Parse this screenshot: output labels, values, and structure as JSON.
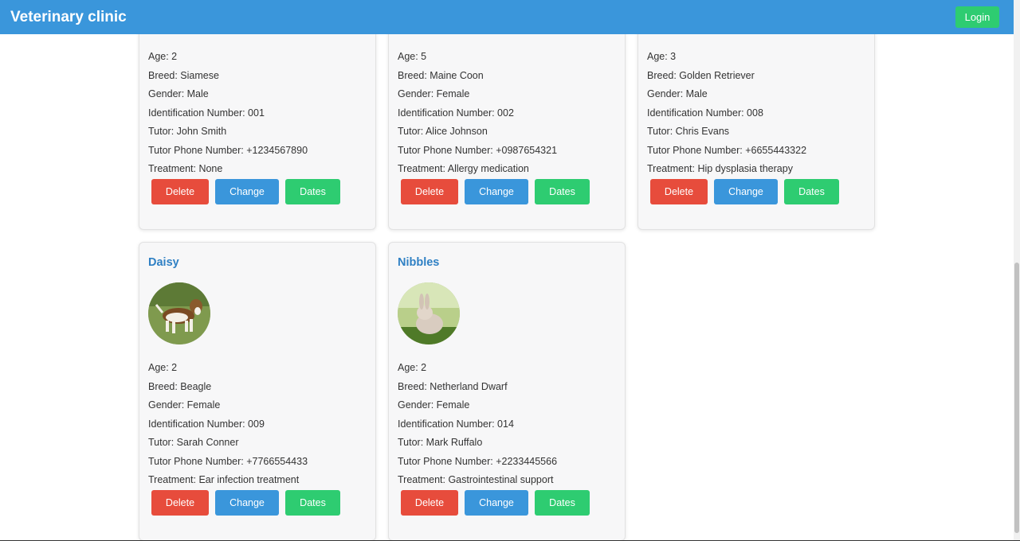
{
  "header": {
    "title": "Veterinary clinic",
    "login_label": "Login"
  },
  "actions": {
    "delete": "Delete",
    "change": "Change",
    "dates": "Dates"
  },
  "pets": [
    {
      "name": "",
      "age": "Age: 2",
      "breed": "Breed: Siamese",
      "gender": "Gender: Male",
      "id": "Identification Number: 001",
      "tutor": "Tutor: John Smith",
      "phone": "Tutor Phone Number: +1234567890",
      "treatment": "Treatment: None"
    },
    {
      "name": "",
      "age": "Age: 5",
      "breed": "Breed: Maine Coon",
      "gender": "Gender: Female",
      "id": "Identification Number: 002",
      "tutor": "Tutor: Alice Johnson",
      "phone": "Tutor Phone Number: +0987654321",
      "treatment": "Treatment: Allergy medication"
    },
    {
      "name": "",
      "age": "Age: 3",
      "breed": "Breed: Golden Retriever",
      "gender": "Gender: Male",
      "id": "Identification Number: 008",
      "tutor": "Tutor: Chris Evans",
      "phone": "Tutor Phone Number: +6655443322",
      "treatment": "Treatment: Hip dysplasia therapy"
    },
    {
      "name": "Daisy",
      "age": "Age: 2",
      "breed": "Breed: Beagle",
      "gender": "Gender: Female",
      "id": "Identification Number: 009",
      "tutor": "Tutor: Sarah Conner",
      "phone": "Tutor Phone Number: +7766554433",
      "treatment": "Treatment: Ear infection treatment"
    },
    {
      "name": "Nibbles",
      "age": "Age: 2",
      "breed": "Breed: Netherland Dwarf",
      "gender": "Gender: Female",
      "id": "Identification Number: 014",
      "tutor": "Tutor: Mark Ruffalo",
      "phone": "Tutor Phone Number: +2233445566",
      "treatment": "Treatment: Gastrointestinal support"
    }
  ],
  "colors": {
    "header": "#3a96db",
    "delete": "#e74c3c",
    "change": "#3a96db",
    "dates": "#2ecc71",
    "name": "#2f80c4"
  }
}
